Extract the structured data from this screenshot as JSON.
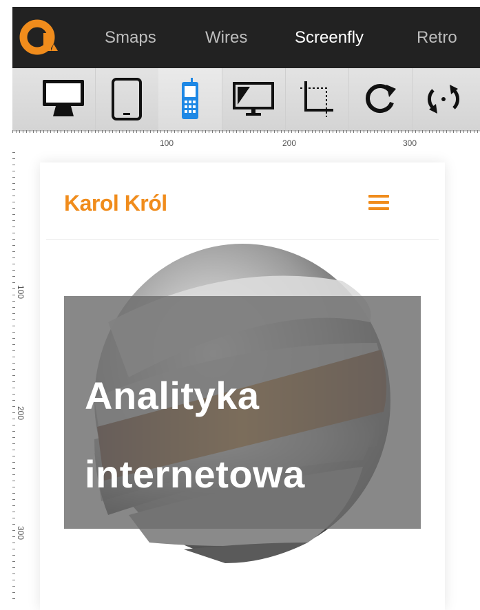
{
  "nav": {
    "items": [
      "Smaps",
      "Wires",
      "Screenfly",
      "Retro"
    ],
    "active": "Screenfly",
    "colors": {
      "bar": "#222222",
      "logo": "#f08c1c",
      "active": "#ffffff",
      "inactive": "#bdbdbd"
    }
  },
  "toolbar": {
    "buttons": [
      "desktop-icon",
      "tablet-icon",
      "mobile-icon",
      "television-icon",
      "custom-size-icon",
      "rotate-icon",
      "scroll-icon"
    ],
    "active": "mobile-icon",
    "accent": "#1e88e5"
  },
  "rulers": {
    "horizontal_labels": [
      "100",
      "200",
      "300"
    ],
    "vertical_labels": [
      "100",
      "200",
      "300"
    ]
  },
  "site": {
    "brand": "Karol Król",
    "hero_line1": "Analityka",
    "hero_line2": "internetowa",
    "accent": "#f08c1c"
  }
}
